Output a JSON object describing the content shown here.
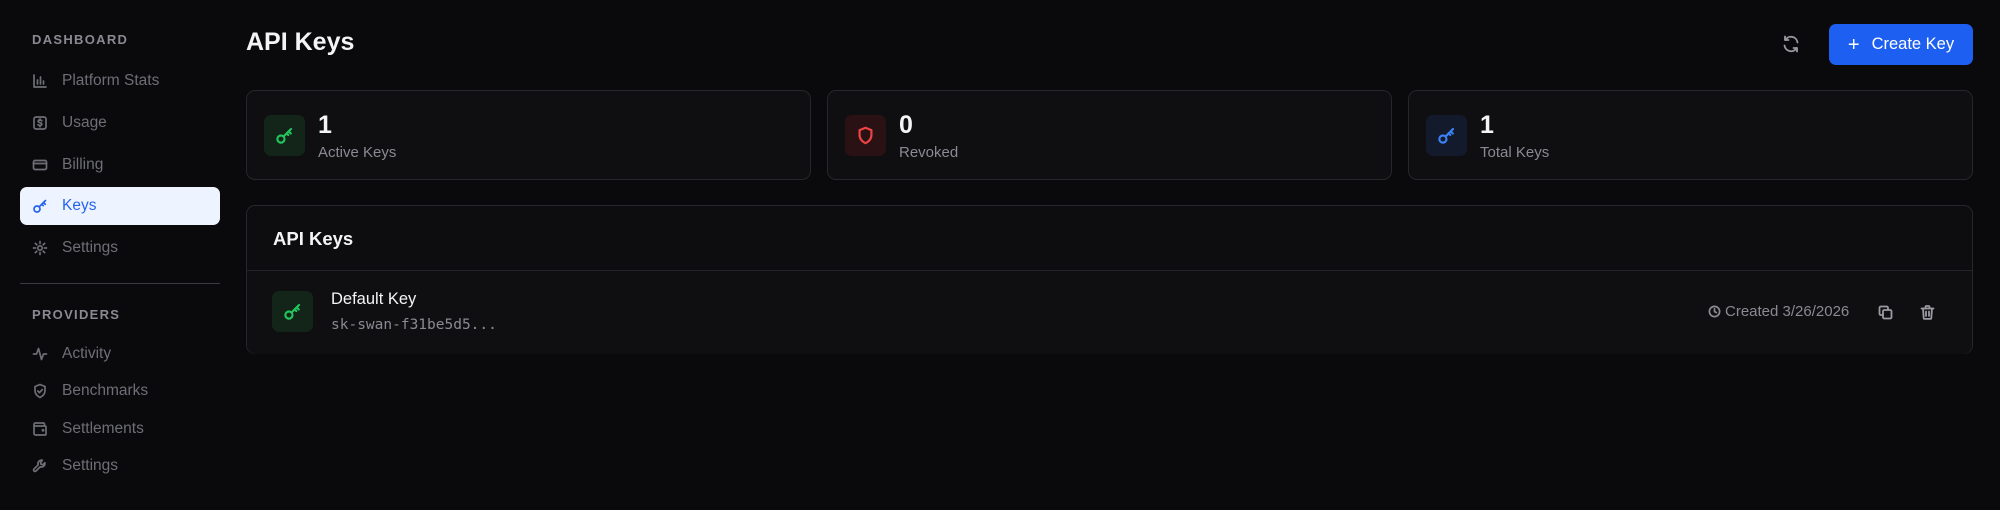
{
  "sidebar": {
    "dashboard_label": "DASHBOARD",
    "dashboard_items": [
      {
        "label": "Platform Stats",
        "icon": "bar-chart-icon"
      },
      {
        "label": "Usage",
        "icon": "dollar-square-icon"
      },
      {
        "label": "Billing",
        "icon": "credit-card-icon"
      },
      {
        "label": "Keys",
        "icon": "key-icon",
        "active": true
      },
      {
        "label": "Settings",
        "icon": "gear-icon"
      }
    ],
    "providers_label": "PROVIDERS",
    "provider_items": [
      {
        "label": "Activity",
        "icon": "activity-icon"
      },
      {
        "label": "Benchmarks",
        "icon": "shield-check-icon"
      },
      {
        "label": "Settlements",
        "icon": "wallet-icon"
      },
      {
        "label": "Settings",
        "icon": "wrench-icon"
      }
    ]
  },
  "header": {
    "title": "API Keys",
    "refresh_icon": "refresh-icon",
    "create_label": "Create Key"
  },
  "stats": [
    {
      "value": "1",
      "label": "Active Keys",
      "icon": "key-icon",
      "color": "#22c55e",
      "bg": "#132419"
    },
    {
      "value": "0",
      "label": "Revoked",
      "icon": "shield-icon",
      "color": "#ef4444",
      "bg": "#2a1214"
    },
    {
      "value": "1",
      "label": "Total Keys",
      "icon": "key-icon",
      "color": "#3b82f6",
      "bg": "#121a2c"
    }
  ],
  "keys_panel": {
    "title": "API Keys",
    "keys": [
      {
        "name": "Default Key",
        "secret": "sk-swan-f31be5d5...",
        "created": "Created 3/26/2026"
      }
    ]
  },
  "colors": {
    "accent": "#1d5ff0",
    "background": "#0a0a0c",
    "active_nav_bg": "#eef4ff"
  }
}
